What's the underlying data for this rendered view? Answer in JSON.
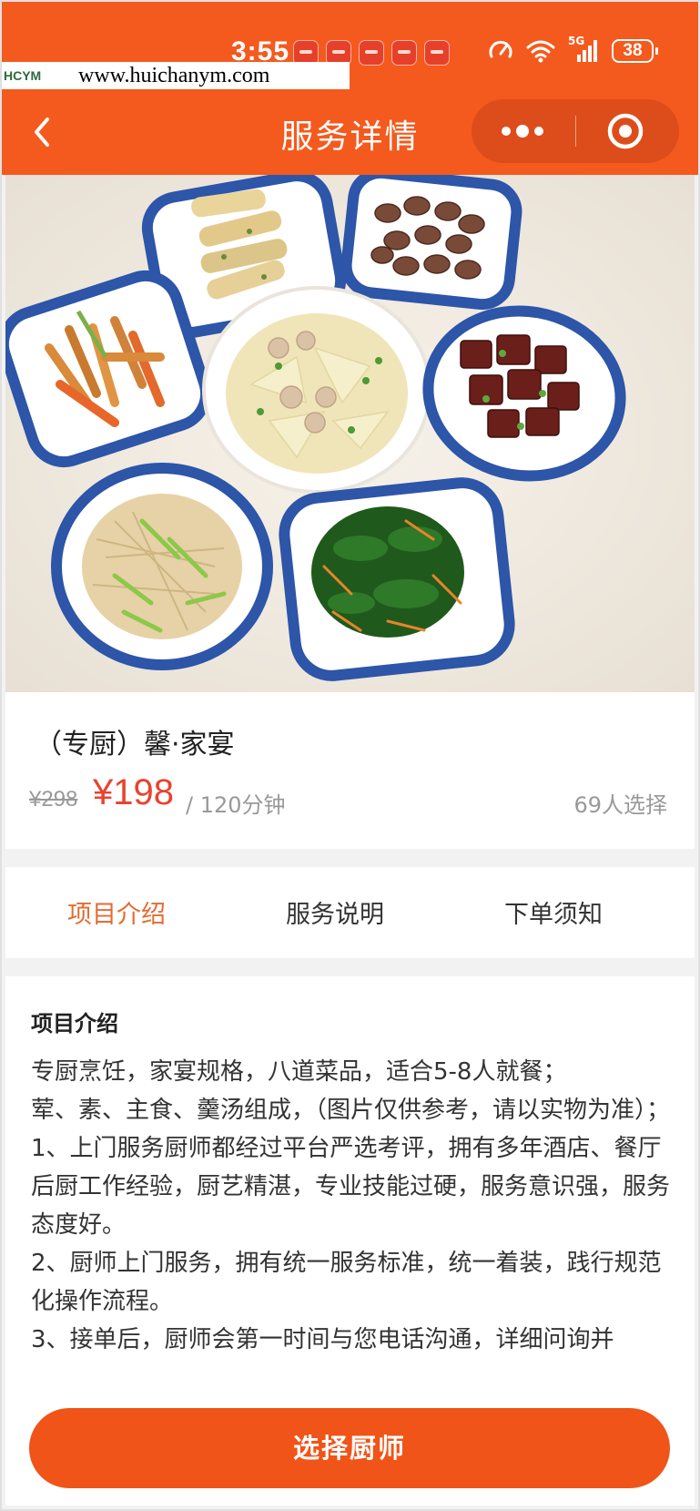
{
  "status_bar": {
    "time": "3:55",
    "network": "5G",
    "battery": "38",
    "notification_icons": [
      "huawei-app-icon",
      "huawei-app-icon",
      "huawei-app-icon",
      "huawei-app-icon",
      "huawei-app-icon"
    ]
  },
  "watermark": {
    "logo": "HCYM",
    "url": "www.huichanym.com"
  },
  "navbar": {
    "title": "服务详情",
    "back_icon": "chevron-left-icon",
    "more_icon": "more-dots-icon",
    "close_icon": "target-circle-icon"
  },
  "product": {
    "title": "（专厨）馨·家宴",
    "original_price": "¥298",
    "price": "¥198",
    "duration": "/ 120分钟",
    "selected_count": "69人选择"
  },
  "tabs": [
    {
      "label": "项目介绍",
      "active": true
    },
    {
      "label": "服务说明",
      "active": false
    },
    {
      "label": "下单须知",
      "active": false
    }
  ],
  "content": {
    "heading": "项目介绍",
    "paragraphs": [
      "专厨烹饪，家宴规格，八道菜品，适合5-8人就餐；",
      "荤、素、主食、羹汤组成，（图片仅供参考，请以实物为准）；",
      "1、上门服务厨师都经过平台严选考评，拥有多年酒店、餐厅后厨工作经验，厨艺精湛，专业技能过硬，服务意识强，服务态度好。",
      "2、厨师上门服务，拥有统一服务标准，统一着装，践行规范化操作流程。",
      "3、接单后，厨师会第一时间与您电话沟通，详细问询并"
    ]
  },
  "cta": {
    "label": "选择厨师"
  },
  "colors": {
    "brand": "#f45a1e",
    "price": "#e8432e",
    "active_tab": "#e36b33"
  }
}
